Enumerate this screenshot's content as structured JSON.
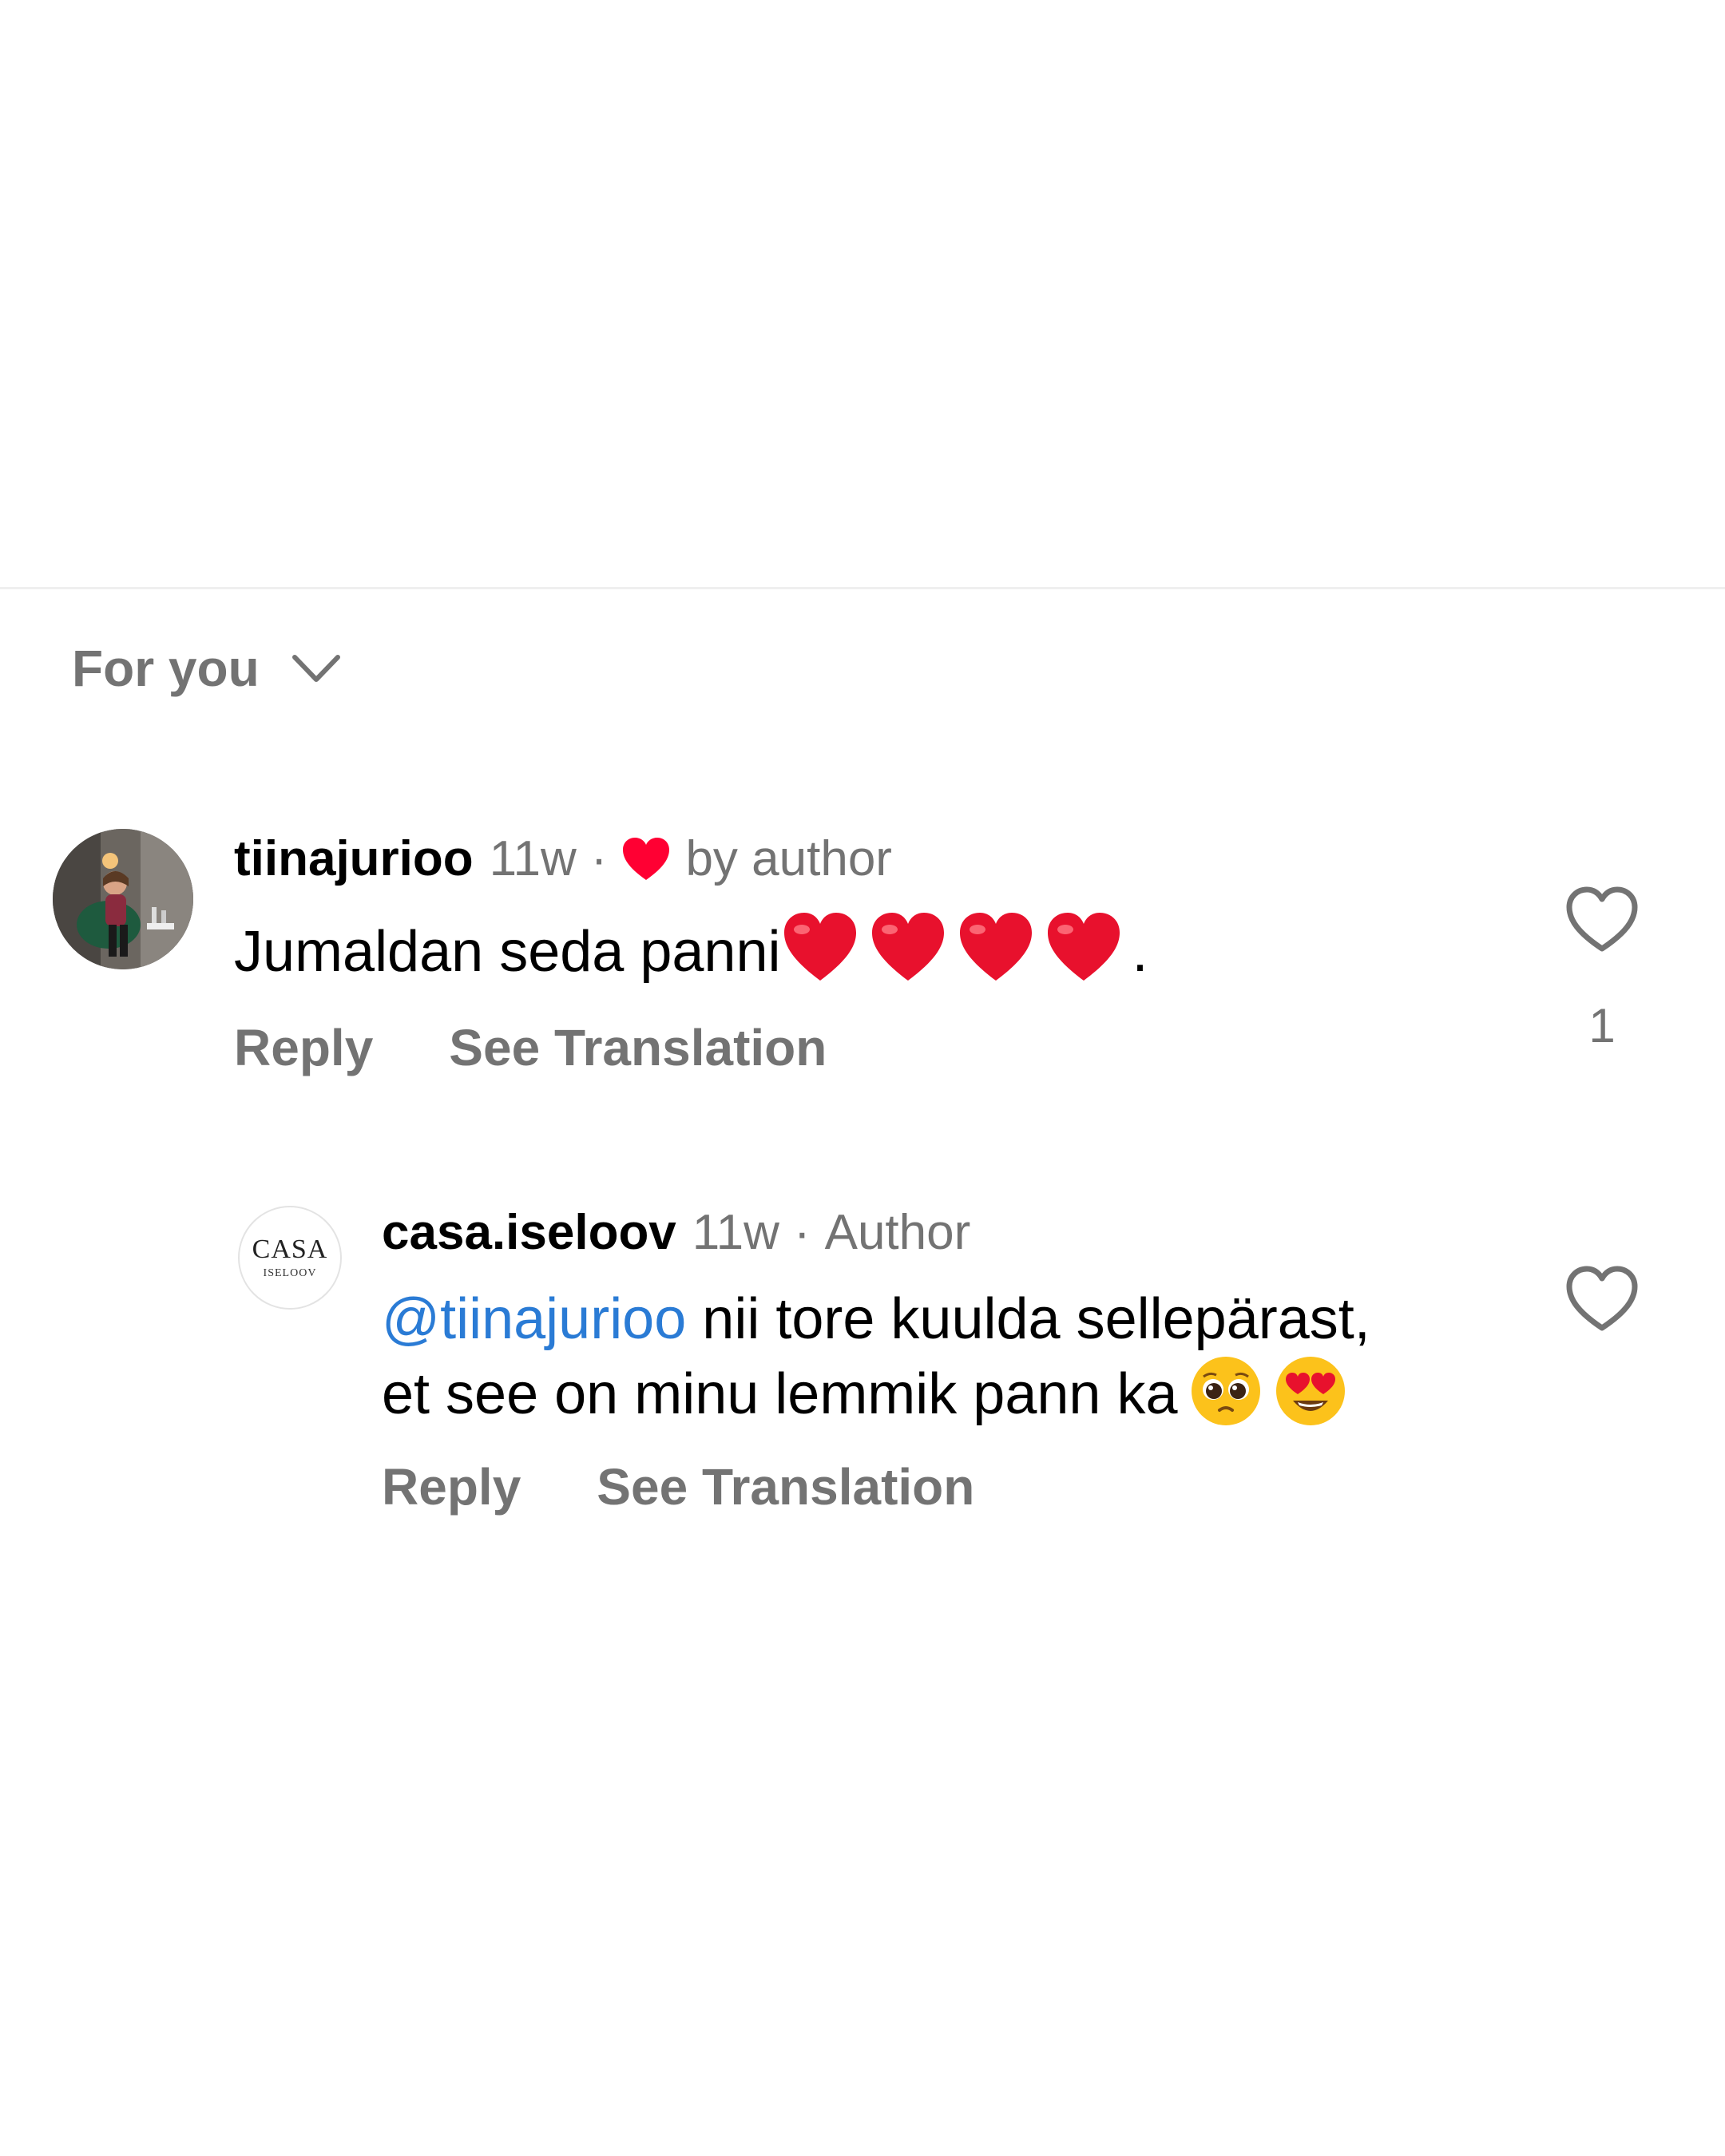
{
  "sort": {
    "label": "For you"
  },
  "comments": [
    {
      "username": "tiinajurioo",
      "time": "11w",
      "separator": "·",
      "liked_by_author_label": "by author",
      "text": "Jumaldan seda panni",
      "text_suffix": ".",
      "emojis": [
        "red-heart",
        "red-heart",
        "red-heart",
        "red-heart"
      ],
      "reply_label": "Reply",
      "translate_label": "See Translation",
      "like_count": "1"
    }
  ],
  "reply": {
    "username": "casa.iseloov",
    "time": "11w",
    "separator": "·",
    "author_tag": "Author",
    "avatar_text_top": "CASA",
    "avatar_text_bottom": "ISELOOV",
    "mention": "@tiinajurioo",
    "text_line1": " nii tore kuulda sellepärast,",
    "text_line2": "et see on minu lemmik pann ka",
    "emojis": [
      "pleading-face",
      "heart-eyes-face"
    ],
    "reply_label": "Reply",
    "translate_label": "See Translation"
  },
  "colors": {
    "like_heart": "#ff0033",
    "mention": "#2a7bd5",
    "muted": "#737373"
  }
}
